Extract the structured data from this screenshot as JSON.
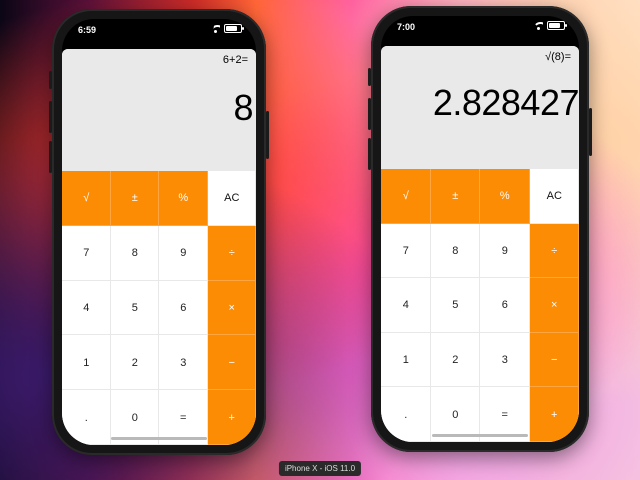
{
  "simulators": [
    {
      "status_time": "6:59",
      "expression": "6+2=",
      "result": "8",
      "keys": [
        "√",
        "±",
        "%",
        "AC",
        "7",
        "8",
        "9",
        "÷",
        "4",
        "5",
        "6",
        "×",
        "1",
        "2",
        "3",
        "−",
        ".",
        "0",
        "=",
        "+"
      ]
    },
    {
      "status_time": "7:00",
      "expression": "√(8)=",
      "result": "2.828427",
      "keys": [
        "√",
        "±",
        "%",
        "AC",
        "7",
        "8",
        "9",
        "÷",
        "4",
        "5",
        "6",
        "×",
        "1",
        "2",
        "3",
        "−",
        ".",
        "0",
        "=",
        "+"
      ]
    }
  ],
  "device_label": "iPhone X - iOS 11.0",
  "colors": {
    "operator": "#fd8c05",
    "display_bg": "#e9e9e9",
    "key_bg": "#ffffff"
  },
  "icons": [
    "cellular-signal-icon",
    "wifi-icon",
    "battery-icon",
    "home-indicator"
  ]
}
